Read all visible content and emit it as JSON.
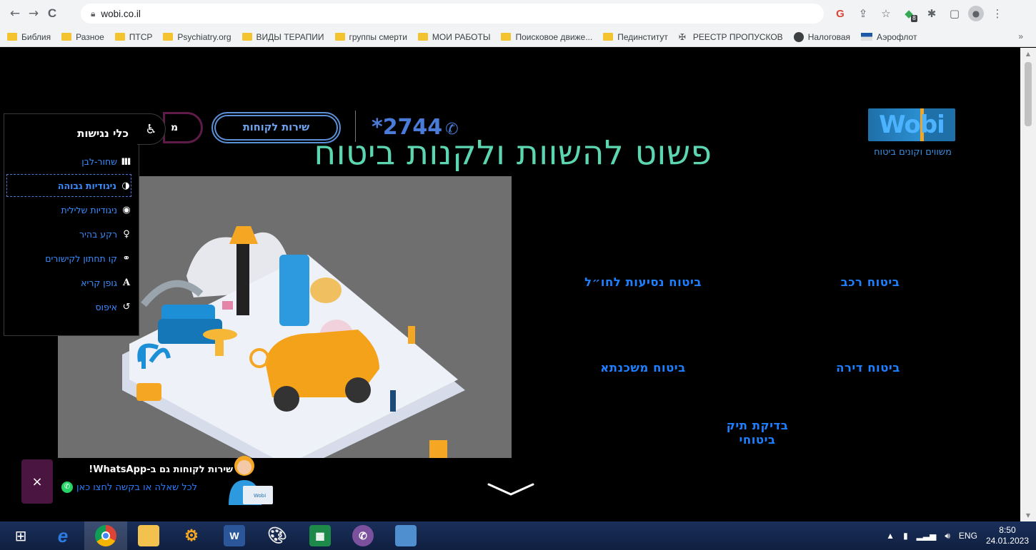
{
  "browser": {
    "url": "wobi.co.il",
    "nav_back": "←",
    "nav_forward": "→",
    "nav_reload": "C",
    "ext_badge": "8",
    "bookmarks_more": "»"
  },
  "bookmarks": [
    {
      "label": "Библия",
      "icon": "folder"
    },
    {
      "label": "Разное",
      "icon": "folder"
    },
    {
      "label": "ПТСР",
      "icon": "folder"
    },
    {
      "label": "Psychiatry.org",
      "icon": "folder"
    },
    {
      "label": "ВИДЫ ТЕРАПИИ",
      "icon": "folder"
    },
    {
      "label": "группы смерти",
      "icon": "folder"
    },
    {
      "label": "МОИ РАБОТЫ",
      "icon": "folder"
    },
    {
      "label": "Поисковое движе...",
      "icon": "folder"
    },
    {
      "label": "Пединститут",
      "icon": "folder"
    },
    {
      "label": "РЕЕСТР ПРОПУСКОВ",
      "icon": "emblem"
    },
    {
      "label": "Налоговая",
      "icon": "globe"
    },
    {
      "label": "Аэрофлот",
      "icon": "flag"
    }
  ],
  "header": {
    "logo_text": "Wobi",
    "logo_tagline": "משווים וקונים ביטוח",
    "phone": "*2744",
    "service_button": "שירות לקוחות",
    "purple_button": "מ",
    "hero_title": "פשוט להשוות ולקנות ביטוח"
  },
  "insurance_links": {
    "car": "ביטוח רכב",
    "travel": "ביטוח נסיעות לחו״ל",
    "apartment": "ביטוח דירה",
    "mortgage": "ביטוח משכנתא",
    "policy_check": "בדיקת תיק ביטוחי"
  },
  "accessibility": {
    "title": "כלי נגישות",
    "items": [
      {
        "label": "שחור-לבן",
        "icon": "▌▌▌"
      },
      {
        "label": "ניגודיות גבוהה",
        "icon": "◑"
      },
      {
        "label": "ניגודיות שלילית",
        "icon": "◉"
      },
      {
        "label": "רקע בהיר",
        "icon": "♀"
      },
      {
        "label": "קו תחתון לקישורים",
        "icon": "⚭"
      },
      {
        "label": "גופן קריא",
        "icon": "A"
      },
      {
        "label": "איפוס",
        "icon": "↺"
      }
    ]
  },
  "whatsapp": {
    "title": "שירות לקוחות גם ב-WhatsApp!",
    "subtitle": "לכל שאלה או בקשה לחצו כאן",
    "close": "×",
    "laptop_brand": "Wobi"
  },
  "taskbar": {
    "lang": "ENG",
    "time": "8:50",
    "date": "24.01.2023"
  },
  "colors": {
    "accent_blue": "#1e80ff",
    "hero_teal": "#5cd6b0",
    "purple": "#5e1b49"
  }
}
